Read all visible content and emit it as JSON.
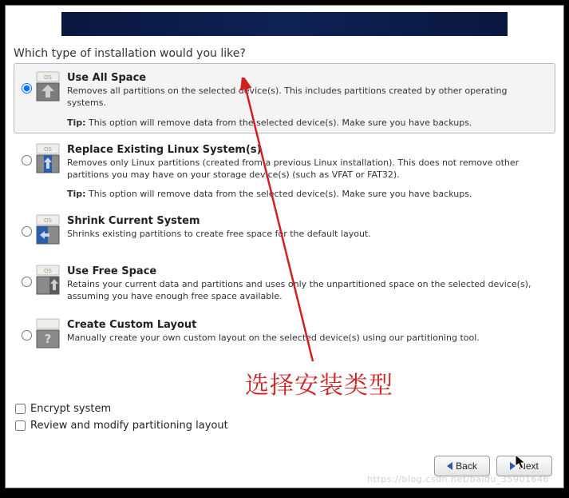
{
  "prompt": "Which type of installation would you like?",
  "options": [
    {
      "title": "Use All Space",
      "desc": "Removes all partitions on the selected device(s).  This includes partitions created by other operating systems.",
      "tip_label": "Tip:",
      "tip": "This option will remove data from the selected device(s).  Make sure you have backups.",
      "selected": true,
      "icon": "use-all"
    },
    {
      "title": "Replace Existing Linux System(s)",
      "desc": "Removes only Linux partitions (created from a previous Linux installation).  This does not remove other partitions you may have on your storage device(s) (such as VFAT or FAT32).",
      "tip_label": "Tip:",
      "tip": "This option will remove data from the selected device(s).  Make sure you have backups.",
      "selected": false,
      "icon": "replace"
    },
    {
      "title": "Shrink Current System",
      "desc": "Shrinks existing partitions to create free space for the default layout.",
      "selected": false,
      "icon": "shrink"
    },
    {
      "title": "Use Free Space",
      "desc": "Retains your current data and partitions and uses only the unpartitioned space on the selected device(s), assuming you have enough free space available.",
      "selected": false,
      "icon": "free"
    },
    {
      "title": "Create Custom Layout",
      "desc": "Manually create your own custom layout on the selected device(s) using our partitioning tool.",
      "selected": false,
      "icon": "custom"
    }
  ],
  "checkboxes": {
    "encrypt": "Encrypt system",
    "review": "Review and modify partitioning layout"
  },
  "buttons": {
    "back": "Back",
    "next": "Next"
  },
  "annotation_text": "选择安装类型",
  "watermark": "https://blog.csdn.net/baidu_35901646"
}
